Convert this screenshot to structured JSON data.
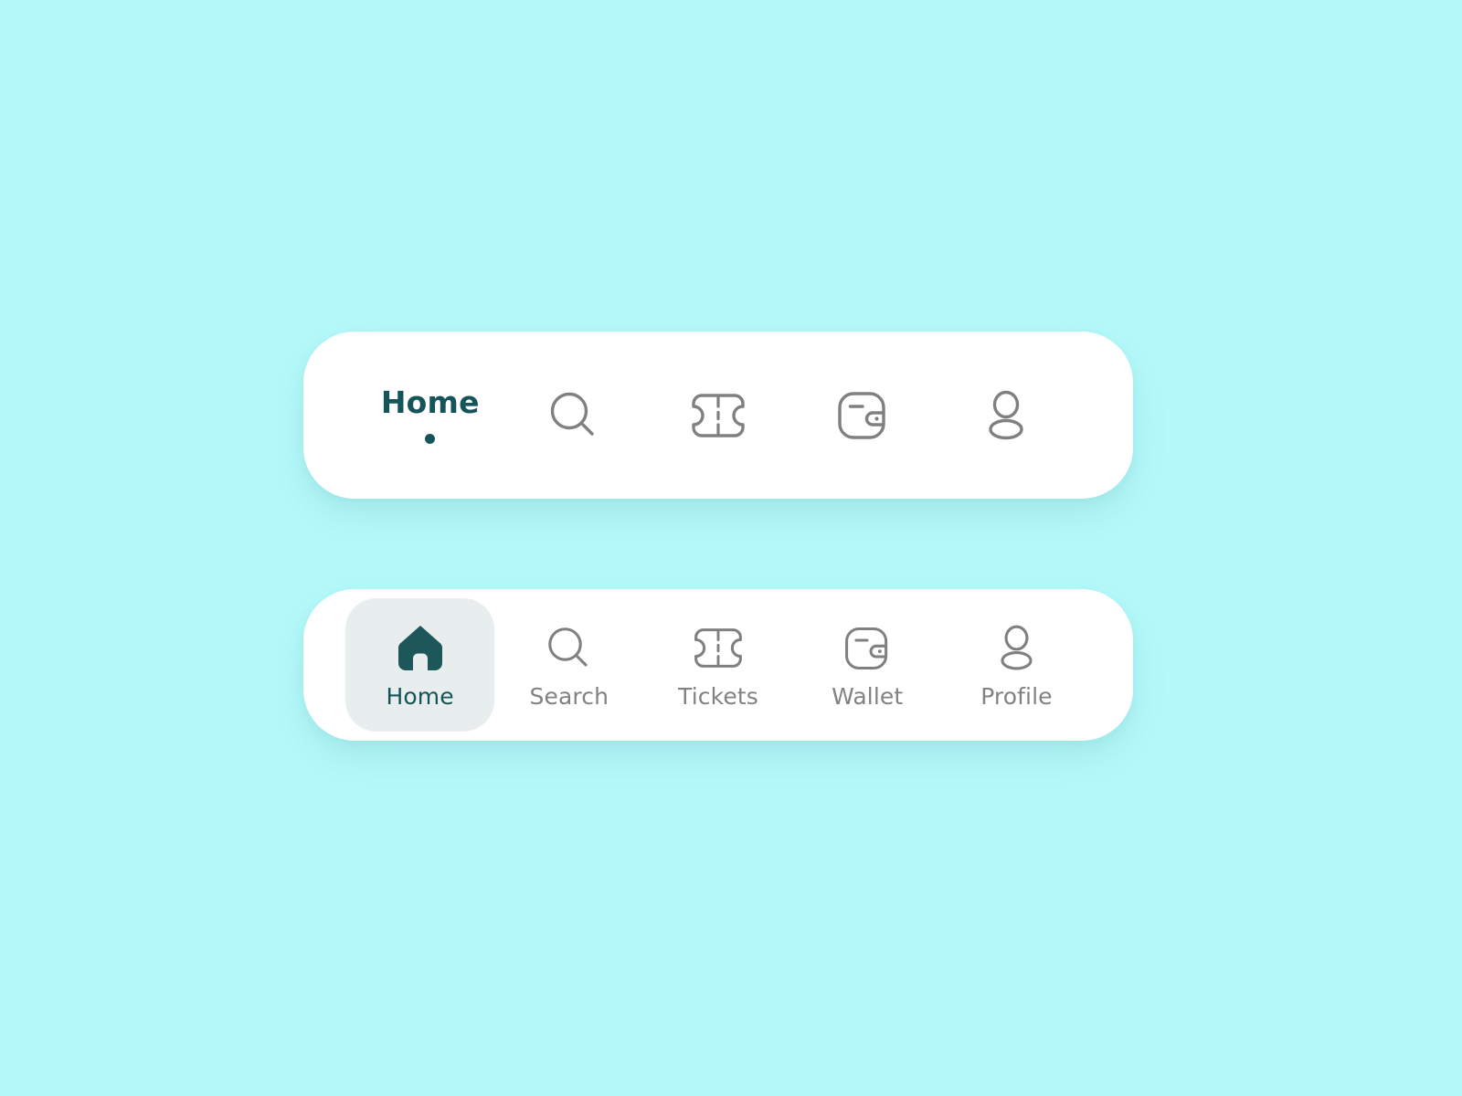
{
  "theme": {
    "page_background": "#b5fafb",
    "card_background": "#ffffff",
    "accent_teal": "#15555a",
    "icon_gray": "#808080",
    "label_gray": "#828282",
    "active_chip_background": "#e8eeed"
  },
  "navbar_compact": {
    "name": "compact-navigation-bar",
    "active_index": 0,
    "items": [
      {
        "label": "Home",
        "icon": "home-icon",
        "show_label": true,
        "state": "active"
      },
      {
        "label": "Search",
        "icon": "search-icon",
        "show_label": false,
        "state": "inactive"
      },
      {
        "label": "Tickets",
        "icon": "ticket-icon",
        "show_label": false,
        "state": "inactive"
      },
      {
        "label": "Wallet",
        "icon": "wallet-icon",
        "show_label": false,
        "state": "inactive"
      },
      {
        "label": "Profile",
        "icon": "profile-icon",
        "show_label": false,
        "state": "inactive"
      }
    ]
  },
  "navbar_labeled": {
    "name": "labeled-navigation-bar",
    "active_index": 0,
    "items": [
      {
        "label": "Home",
        "icon": "home-icon",
        "state": "active"
      },
      {
        "label": "Search",
        "icon": "search-icon",
        "state": "inactive"
      },
      {
        "label": "Tickets",
        "icon": "ticket-icon",
        "state": "inactive"
      },
      {
        "label": "Wallet",
        "icon": "wallet-icon",
        "state": "inactive"
      },
      {
        "label": "Profile",
        "icon": "profile-icon",
        "state": "inactive"
      }
    ]
  }
}
